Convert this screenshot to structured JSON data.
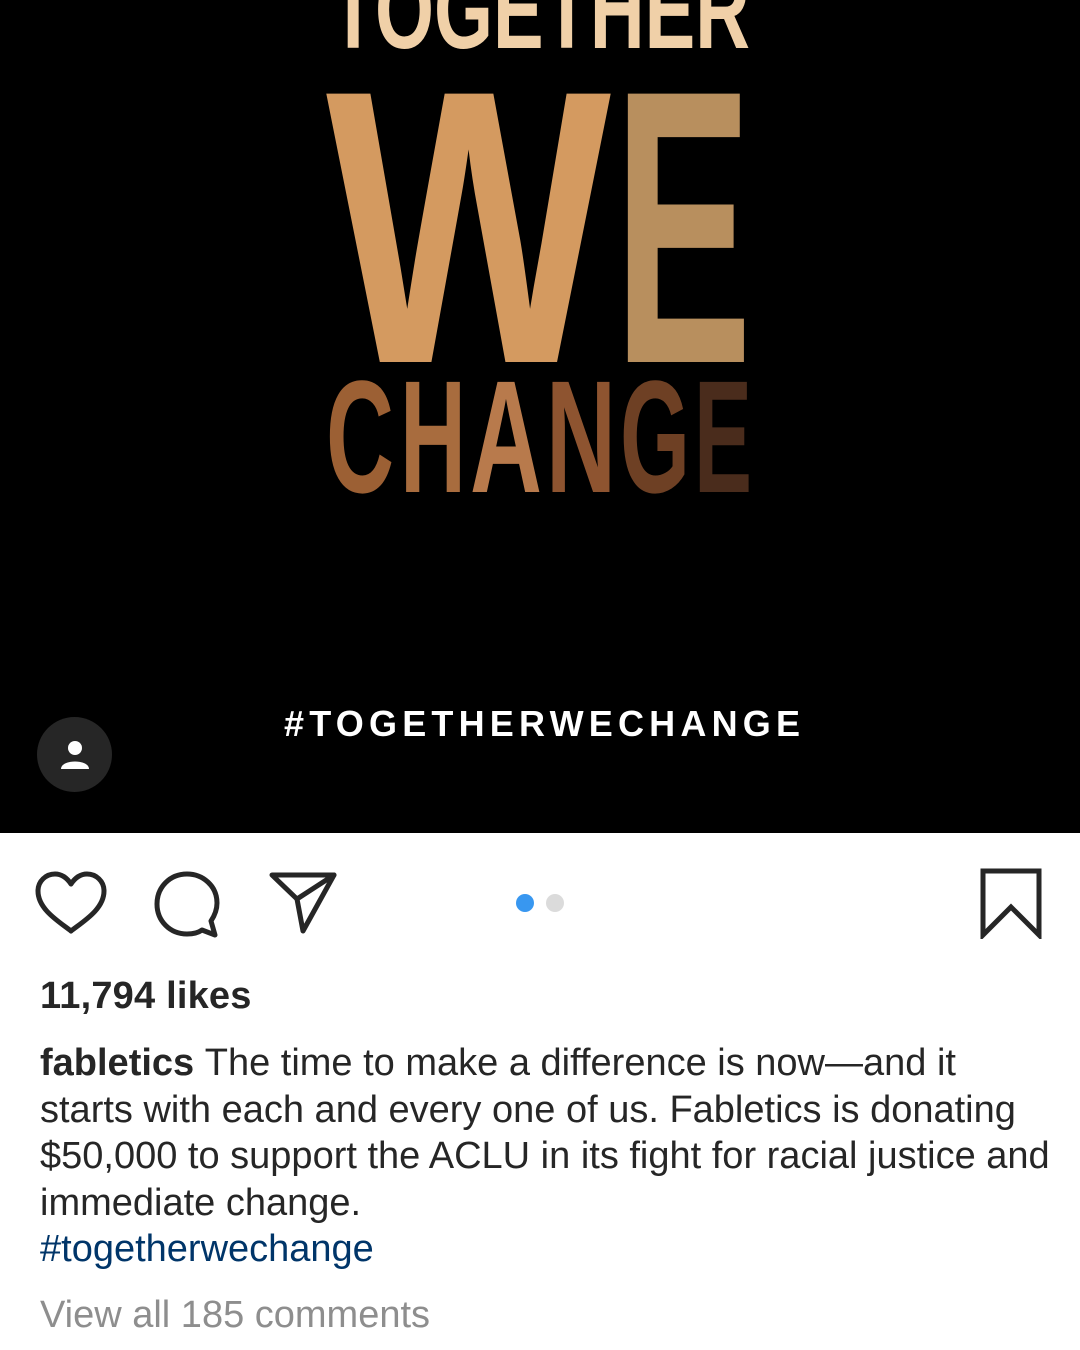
{
  "post_image": {
    "poster": {
      "line_together": "TOGETHER",
      "line_we_w": "W",
      "line_we_e": "E",
      "line_change_letters": [
        "C",
        "H",
        "A",
        "N",
        "G",
        "E"
      ],
      "hashtag_banner": "#TOGETHERWECHANGE"
    },
    "colors": {
      "background": "#000000",
      "together": "#f0d0a8",
      "we_w": "#d49a60",
      "we_e": "#b88f5e",
      "change": [
        "#9c6034",
        "#a86c3e",
        "#b87a4c",
        "#8e5430",
        "#6e4024",
        "#4a2c1c"
      ],
      "hashtag": "#ffffff"
    }
  },
  "user_tag_icon": "person-icon",
  "actions": {
    "like_icon": "heart-icon",
    "comment_icon": "comment-bubble-icon",
    "share_icon": "paper-plane-icon",
    "save_icon": "bookmark-icon"
  },
  "carousel": {
    "count": 2,
    "active_index": 0,
    "active_color": "#3897f0",
    "inactive_color": "#dbdbdb"
  },
  "likes": "11,794 likes",
  "caption": {
    "username": "fabletics",
    "text": "The time to make a difference is now—and it starts with each and every one of us. Fabletics is donating $50,000 to support the ACLU in its fight for racial justice and immediate change.",
    "hashtag": "#togetherwechange"
  },
  "view_comments": "View all 185 comments"
}
